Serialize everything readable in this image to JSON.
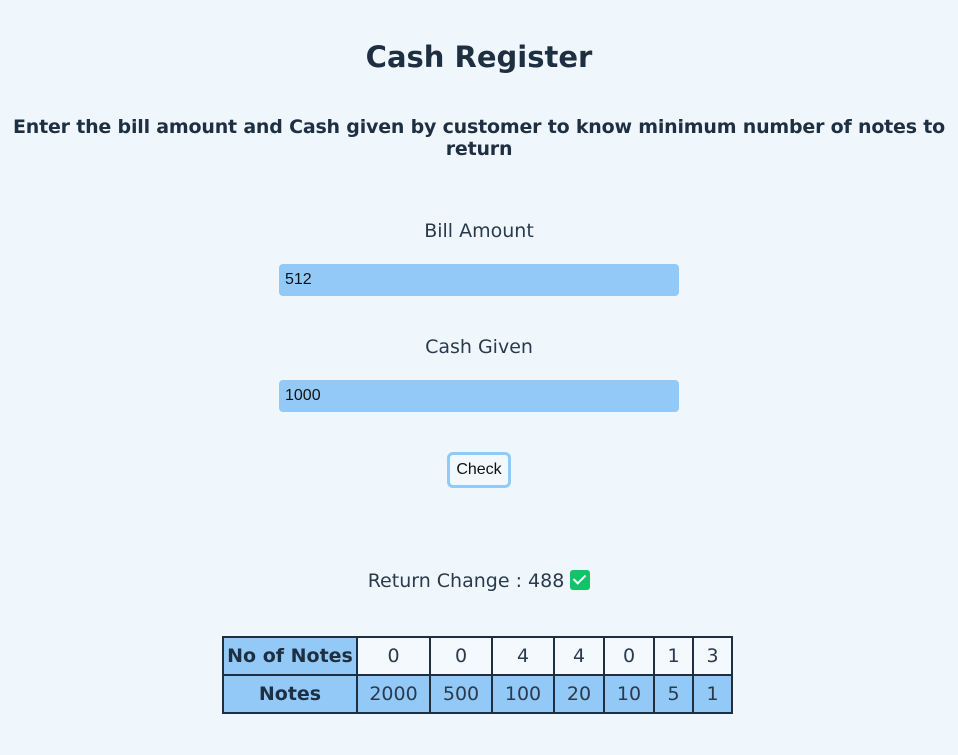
{
  "header": {
    "title": "Cash Register",
    "subtitle": "Enter the bill amount and Cash given by customer to know minimum number of notes to return"
  },
  "form": {
    "bill_label": "Bill Amount",
    "bill_value": "512",
    "cash_label": "Cash Given",
    "cash_value": "1000",
    "check_label": "Check"
  },
  "result": {
    "text": "Return Change : 488",
    "icon": "check-mark-icon",
    "icon_color": "#14c26a"
  },
  "table": {
    "row1_header": "No of Notes",
    "row2_header": "Notes",
    "counts": [
      "0",
      "0",
      "4",
      "4",
      "0",
      "1",
      "3"
    ],
    "denominations": [
      "2000",
      "500",
      "100",
      "20",
      "10",
      "5",
      "1"
    ]
  },
  "colors": {
    "background": "#eff7fd",
    "accent": "#93c9f7",
    "text": "#1e2f42"
  }
}
